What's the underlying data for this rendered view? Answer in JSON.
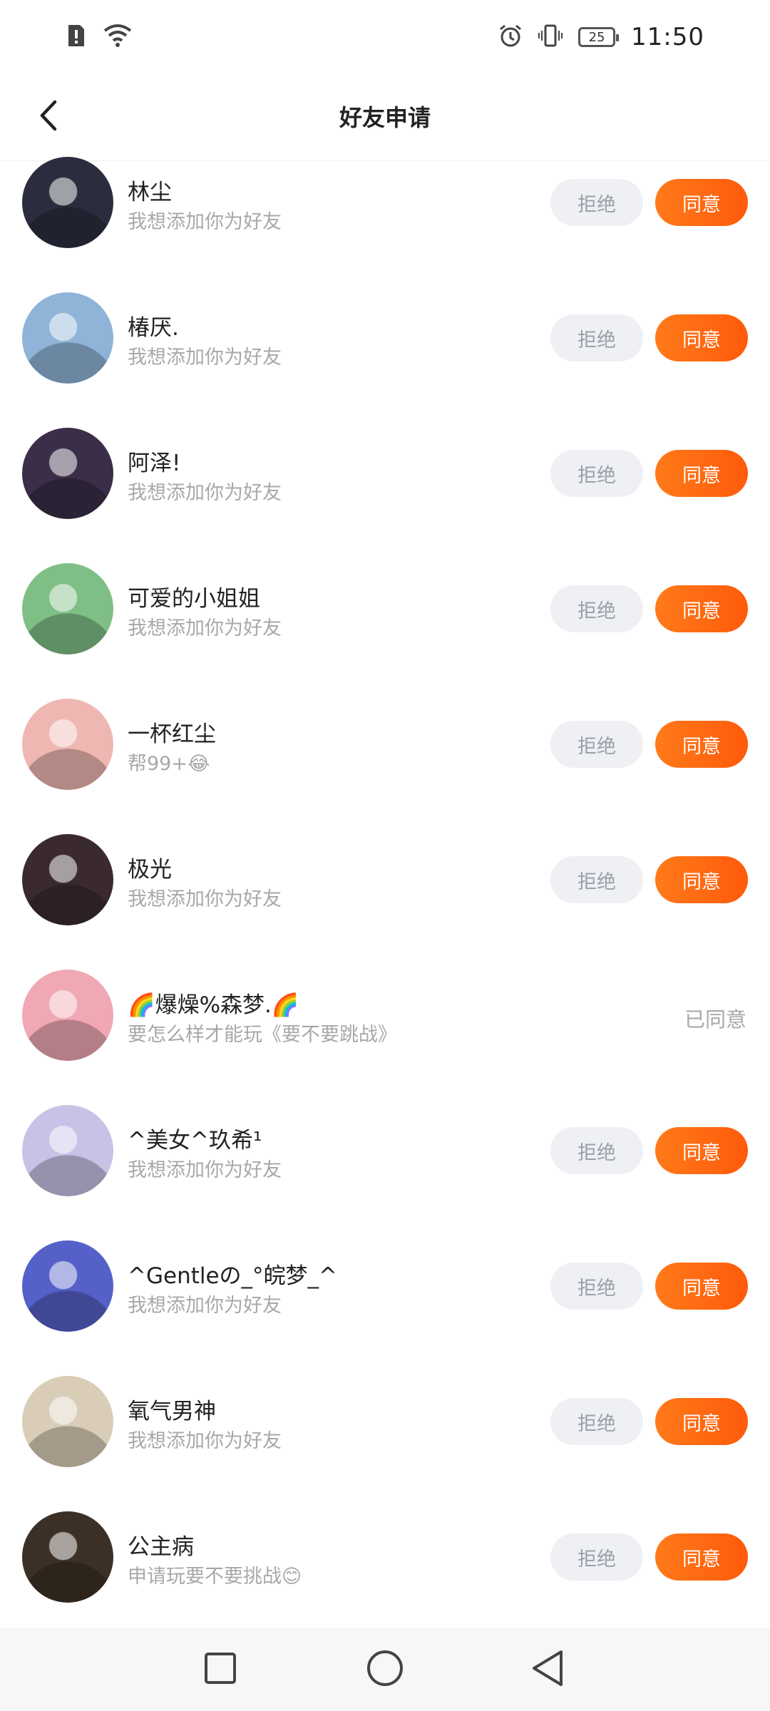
{
  "status_bar": {
    "time": "11:50",
    "battery": "25"
  },
  "header": {
    "title": "好友申请"
  },
  "labels": {
    "reject": "拒绝",
    "agree": "同意",
    "agreed": "已同意"
  },
  "requests": [
    {
      "name": "林尘",
      "message": "我想添加你为好友",
      "status": "pending",
      "avatar_color": "#2b2d3f"
    },
    {
      "name": "椿厌.",
      "message": "我想添加你为好友",
      "status": "pending",
      "avatar_color": "#8fb4d8"
    },
    {
      "name": "阿泽!",
      "message": "我想添加你为好友",
      "status": "pending",
      "avatar_color": "#3a2e48"
    },
    {
      "name": "可爱的小姐姐",
      "message": "我想添加你为好友",
      "status": "pending",
      "avatar_color": "#7fbf86"
    },
    {
      "name": "一杯红尘",
      "message": "帮99+😂",
      "status": "pending",
      "avatar_color": "#efb7b2"
    },
    {
      "name": "极光",
      "message": "我想添加你为好友",
      "status": "pending",
      "avatar_color": "#3a2a30"
    },
    {
      "name": "🌈爆燥%森梦.🌈",
      "message": "要怎么样才能玩《要不要跳战》",
      "status": "agreed",
      "avatar_color": "#f0a8b4"
    },
    {
      "name": "^美女^玖希¹",
      "message": "我想添加你为好友",
      "status": "pending",
      "avatar_color": "#c8c2e6"
    },
    {
      "name": "^Gentleの_°皖梦_^",
      "message": "我想添加你为好友",
      "status": "pending",
      "avatar_color": "#5560c8"
    },
    {
      "name": "氧气男神",
      "message": "我想添加你为好友",
      "status": "pending",
      "avatar_color": "#d9cdb8"
    },
    {
      "name": "公主病",
      "message": "申请玩要不要挑战😊",
      "status": "pending",
      "avatar_color": "#3c3026"
    }
  ]
}
